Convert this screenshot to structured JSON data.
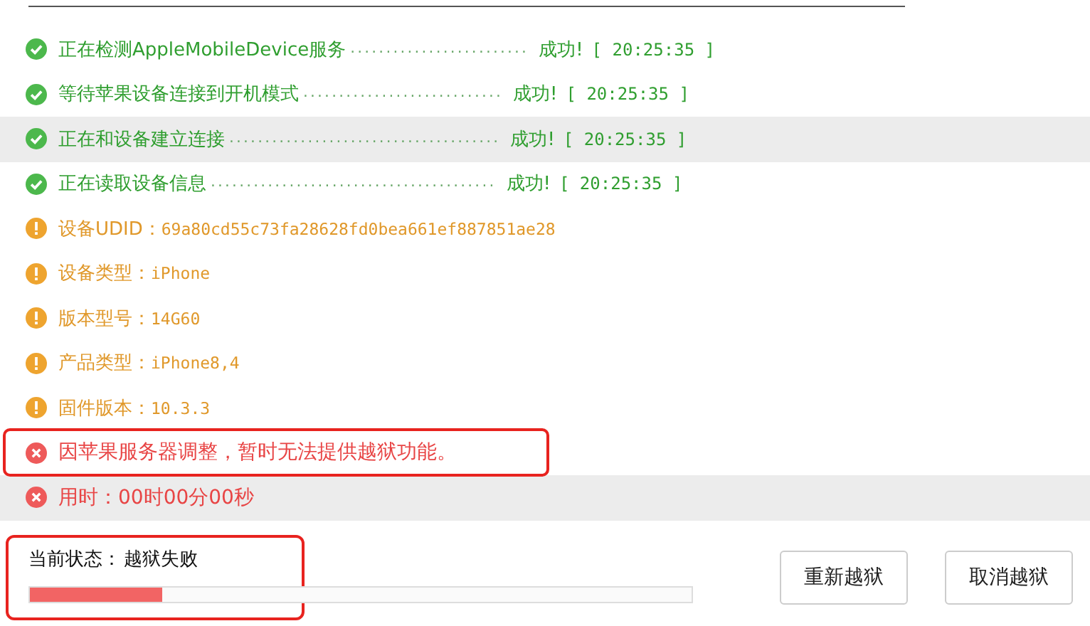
{
  "log": [
    {
      "kind": "success",
      "text": "正在检测AppleMobileDevice服务",
      "dots": ".........................",
      "status": "成功!",
      "time": "[ 20:25:35 ]",
      "highlighted": false,
      "annotated": false
    },
    {
      "kind": "success",
      "text": "等待苹果设备连接到开机模式",
      "dots": "............................",
      "status": "成功!",
      "time": "[ 20:25:35 ]",
      "highlighted": false,
      "annotated": false
    },
    {
      "kind": "success",
      "text": "正在和设备建立连接",
      "dots": "......................................",
      "status": "成功!",
      "time": "[ 20:25:35 ]",
      "highlighted": true,
      "annotated": false
    },
    {
      "kind": "success",
      "text": "正在读取设备信息",
      "dots": "........................................",
      "status": "成功!",
      "time": "[ 20:25:35 ]",
      "highlighted": false,
      "annotated": false
    },
    {
      "kind": "info",
      "label": "设备UDID：",
      "value": "69a80cd55c73fa28628fd0bea661ef887851ae28",
      "highlighted": false,
      "annotated": false
    },
    {
      "kind": "info",
      "label": "设备类型：",
      "value": "iPhone",
      "highlighted": false,
      "annotated": false
    },
    {
      "kind": "info",
      "label": "版本型号：",
      "value": "14G60",
      "highlighted": false,
      "annotated": false
    },
    {
      "kind": "info",
      "label": "产品类型：",
      "value": "iPhone8,4",
      "highlighted": false,
      "annotated": false
    },
    {
      "kind": "info",
      "label": "固件版本：",
      "value": "10.3.3",
      "highlighted": false,
      "annotated": false
    },
    {
      "kind": "error",
      "text": "因苹果服务器调整，暂时无法提供越狱功能。",
      "highlighted": false,
      "annotated": true
    },
    {
      "kind": "error",
      "text": "用时：00时00分00秒",
      "highlighted": true,
      "annotated": false
    }
  ],
  "status": {
    "label": "当前状态：",
    "value": "越狱失败",
    "level": 0.2,
    "annotated": true
  },
  "buttons": [
    "重新越狱",
    "取消越狱"
  ]
}
